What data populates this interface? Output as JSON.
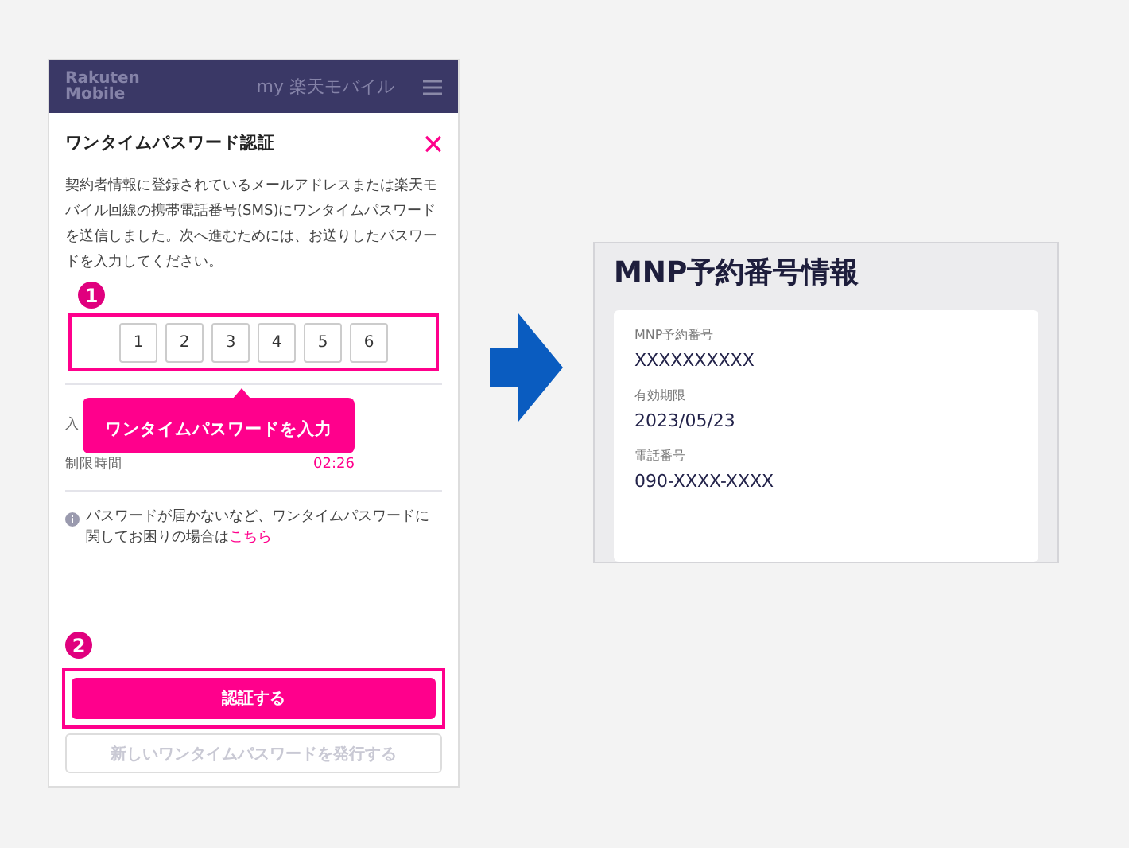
{
  "header": {
    "logo": [
      "Rakuten",
      "Mobile"
    ],
    "title": "my 楽天モバイル"
  },
  "modal": {
    "title": "ワンタイムパスワード認証",
    "description": "契約者情報に登録されているメールアドレスまたは楽天モバイル回線の携帯電話番号(SMS)にワンタイムパスワードを送信しました。次へ進むためには、お送りしたパスワードを入力してください。",
    "code_digits": [
      "1",
      "2",
      "3",
      "4",
      "5",
      "6"
    ],
    "input_label": "入",
    "timer_label": "制限時間",
    "timer": "02:26",
    "help": {
      "text": "パスワードが届かないなど、ワンタイムパスワードに関してお困りの場合は",
      "link": "こちら"
    },
    "primary_button": "認証する",
    "secondary_button": {
      "label": "新しいワンタイムパスワードを発行する",
      "disabled": true
    }
  },
  "annotations": {
    "steps": [
      "1",
      "2"
    ],
    "tooltip": "ワンタイムパスワードを入力"
  },
  "result": {
    "title": "MNP予約番号情報",
    "fields": [
      {
        "label": "MNP予約番号",
        "value": "XXXXXXXXXX"
      },
      {
        "label": "有効期限",
        "value": "2023/05/23"
      },
      {
        "label": "電話番号",
        "value": "090-XXXX-XXXX"
      }
    ]
  }
}
